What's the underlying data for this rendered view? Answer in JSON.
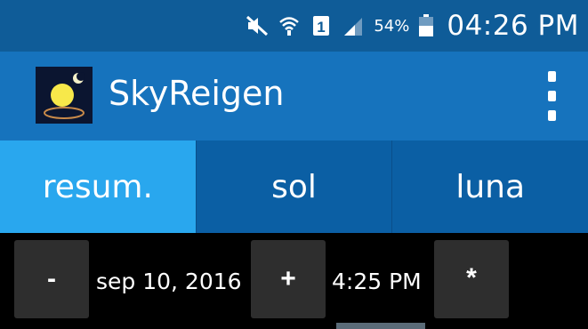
{
  "status_bar": {
    "icons": [
      "mute-icon",
      "wifi-icon",
      "sim-1-icon",
      "signal-icon",
      "battery-icon"
    ],
    "battery_percent": "54%",
    "time": "04:26 PM"
  },
  "app_bar": {
    "title": "SkyReigen",
    "logo": "sun-moon-logo-icon",
    "menu_icon": "overflow-menu-icon"
  },
  "tabs": [
    {
      "label": "resum.",
      "active": true
    },
    {
      "label": "sol",
      "active": false
    },
    {
      "label": "luna",
      "active": false
    }
  ],
  "controls": {
    "minus_label": "-",
    "date": "sep 10, 2016",
    "plus_label": "+",
    "time": "4:25 PM",
    "star_label": "*"
  },
  "colors": {
    "status_bar": "#0f5c98",
    "action_bar": "#1673bd",
    "tab_bar": "#0b5fa4",
    "tab_active": "#29a7ee",
    "toolbar": "#000000",
    "button": "#2e2e2e"
  }
}
